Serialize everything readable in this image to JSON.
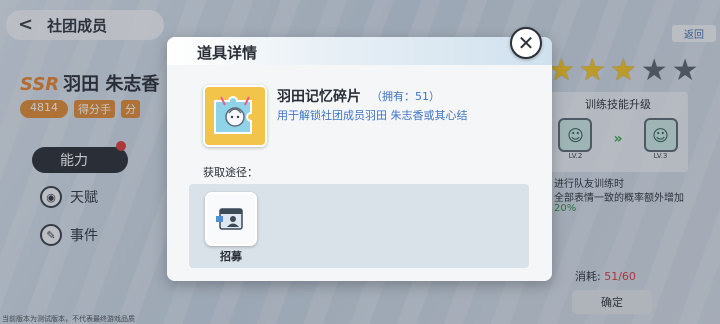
{
  "background": {
    "nav_title": "社团成员",
    "character": {
      "rarity": "SSR",
      "name": "羽田 朱志香",
      "power": "4814",
      "tag": "得分手",
      "tag2": "分"
    },
    "ability_label": "能力",
    "side_items": [
      "天赋",
      "事件"
    ],
    "build_note": "当前版本为测试版本，不代表最终游戏品质",
    "return_label": "返回",
    "stars": {
      "filled": 3,
      "total": 5
    },
    "skill_panel": {
      "title": "训练技能升级",
      "from_level": "LV.2",
      "to_level": "LV.3",
      "desc_line1": "进行队友训练时",
      "desc_line2": "全部表情一致的概率额外增加",
      "desc_line3": "20%"
    },
    "cost": {
      "label": "消耗:",
      "value": "51/60"
    },
    "confirm_label": "确定"
  },
  "dialog": {
    "title": "道具详情",
    "close_icon": "close-icon",
    "item": {
      "name": "羽田记忆碎片",
      "owned": "（拥有：51）",
      "description": "用于解锁社团成员羽田 朱志香或其心结",
      "icon": "memory-fragment-icon"
    },
    "source_label": "获取途径：",
    "sources": [
      {
        "label": "招募",
        "icon": "recruit-icon"
      }
    ]
  },
  "colors": {
    "accent_blue": "#3f74c6",
    "item_gold": "#f3c44a",
    "rarity_orange": "#e9862e"
  }
}
